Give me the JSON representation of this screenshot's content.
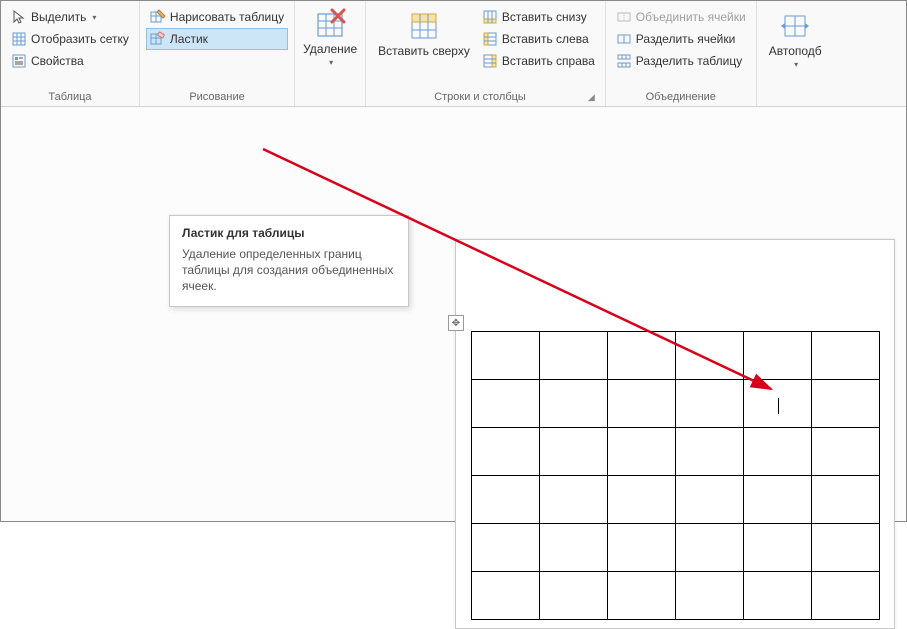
{
  "ribbon": {
    "table_group": {
      "label": "Таблица",
      "select": "Выделить",
      "show_grid": "Отобразить сетку",
      "properties": "Свойства"
    },
    "draw_group": {
      "label": "Рисование",
      "draw_table": "Нарисовать таблицу",
      "eraser": "Ластик"
    },
    "delete_group": {
      "delete": "Удаление"
    },
    "rows_cols_group": {
      "label": "Строки и столбцы",
      "insert_above": "Вставить сверху",
      "insert_below": "Вставить снизу",
      "insert_left": "Вставить слева",
      "insert_right": "Вставить справа"
    },
    "merge_group": {
      "label": "Объединение",
      "merge_cells": "Объединить ячейки",
      "split_cells": "Разделить ячейки",
      "split_table": "Разделить таблицу"
    },
    "autofit_group": {
      "autofit": "Автоподб"
    }
  },
  "tooltip": {
    "title": "Ластик для таблицы",
    "body": "Удаление определенных границ таблицы для создания объединенных ячеек."
  },
  "table": {
    "rows": 6,
    "cols": 6,
    "cursor_cell": {
      "row": 1,
      "col": 4
    }
  }
}
